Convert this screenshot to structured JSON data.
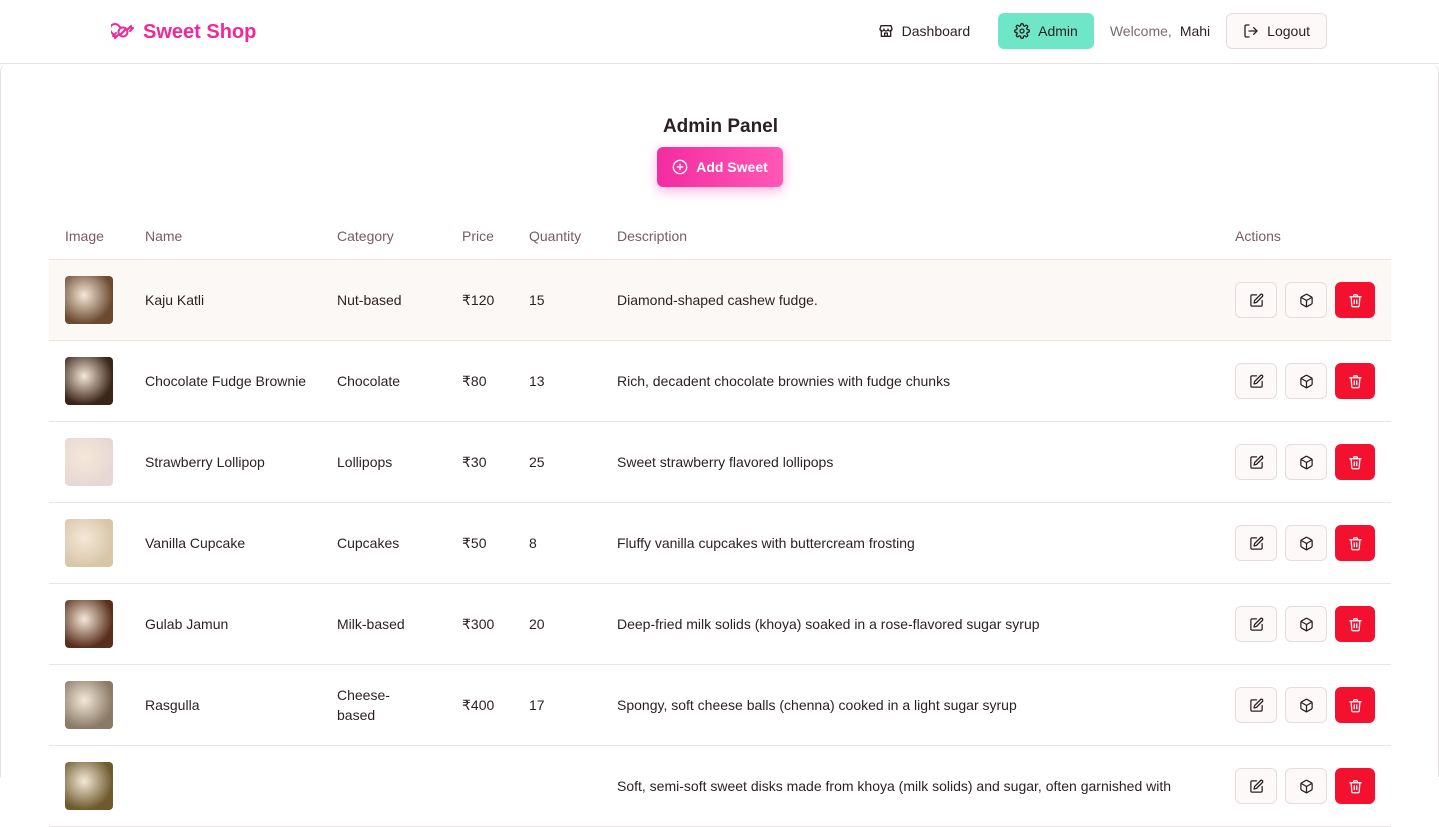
{
  "header": {
    "brand": "Sweet Shop",
    "nav": {
      "dashboard": "Dashboard",
      "admin": "Admin",
      "welcome": "Welcome,",
      "user": "Mahi",
      "logout": "Logout"
    }
  },
  "main": {
    "title": "Admin Panel",
    "add_button": "Add Sweet"
  },
  "table": {
    "columns": [
      "Image",
      "Name",
      "Category",
      "Price",
      "Quantity",
      "Description",
      "Actions"
    ],
    "rows": [
      {
        "name": "Kaju Katli",
        "category": "Nut-based",
        "price": "₹120",
        "quantity": "15",
        "description": "Diamond-shaped cashew fudge.",
        "thumb_color": "#6b4a30"
      },
      {
        "name": "Chocolate Fudge Brownie",
        "category": "Chocolate",
        "price": "₹80",
        "quantity": "13",
        "description": "Rich, decadent chocolate brownies with fudge chunks",
        "thumb_color": "#3b2418"
      },
      {
        "name": "Strawberry Lollipop",
        "category": "Lollipops",
        "price": "₹30",
        "quantity": "25",
        "description": "Sweet strawberry flavored lollipops",
        "thumb_color": "#e8d8d4"
      },
      {
        "name": "Vanilla Cupcake",
        "category": "Cupcakes",
        "price": "₹50",
        "quantity": "8",
        "description": "Fluffy vanilla cupcakes with buttercream frosting",
        "thumb_color": "#d9c6a8"
      },
      {
        "name": "Gulab Jamun",
        "category": "Milk-based",
        "price": "₹300",
        "quantity": "20",
        "description": "Deep-fried milk solids (khoya) soaked in a rose-flavored sugar syrup",
        "thumb_color": "#5a2e1c"
      },
      {
        "name": "Rasgulla",
        "category": "Cheese-based",
        "price": "₹400",
        "quantity": "17",
        "description": "Spongy, soft cheese balls (chenna) cooked in a light sugar syrup",
        "thumb_color": "#8a7a66"
      },
      {
        "name": "",
        "category": "",
        "price": "",
        "quantity": "",
        "description": "Soft, semi-soft sweet disks made from khoya (milk solids) and sugar, often garnished with",
        "thumb_color": "#6e5a2e"
      }
    ]
  },
  "colors": {
    "brand": "#f0289a",
    "admin_active": "#6fe6c8",
    "delete": "#f4102f"
  }
}
